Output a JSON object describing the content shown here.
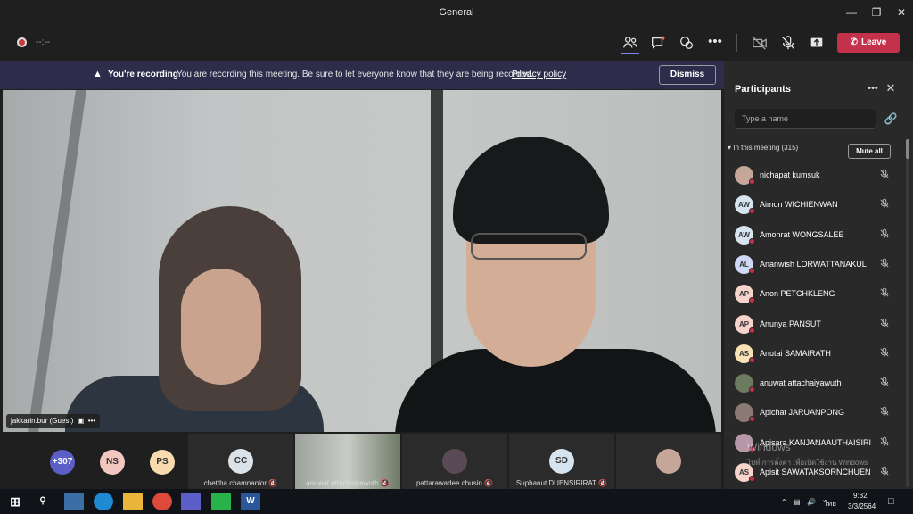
{
  "window": {
    "title": "General"
  },
  "toolbar": {
    "timer": "--:--",
    "leave_label": "Leave"
  },
  "banner": {
    "title": "You're recording",
    "text": "You are recording this meeting. Be sure to let everyone know that they are being recorded.",
    "link": "Privacy policy",
    "dismiss_label": "Dismiss"
  },
  "main_video": {
    "name_tag": "jakkarin.bur (Guest)"
  },
  "strip": {
    "overflow_count": "+307",
    "avatars": [
      {
        "initials": "NS",
        "color": "#f4c6c0"
      },
      {
        "initials": "PS",
        "color": "#f8dcb0"
      }
    ],
    "tiles": [
      {
        "name": "chettha chamnanlor",
        "initials": "CC",
        "kind": "avatar"
      },
      {
        "name": "anuwat attachaiyawuth",
        "kind": "video"
      },
      {
        "name": "pattarawadee chusin",
        "kind": "photo"
      },
      {
        "name": "Suphanut DUENSIRIRAT",
        "initials": "SD",
        "kind": "avatar"
      },
      {
        "name": "",
        "kind": "photo"
      }
    ]
  },
  "panel": {
    "title": "Participants",
    "search_placeholder": "Type a name",
    "section_label": "In this meeting (315)",
    "mute_all_label": "Mute all",
    "participants": [
      {
        "name": "nichapat kumsuk",
        "initials": "",
        "avatar_color": "#c7a69a",
        "photo": true
      },
      {
        "name": "Aimon WICHIENWAN",
        "initials": "AW",
        "avatar_color": "#d6e4f0"
      },
      {
        "name": "Amonrat WONGSALEE",
        "initials": "AW",
        "avatar_color": "#d6e4f0"
      },
      {
        "name": "Ananwish LORWATTANAKUL",
        "initials": "AL",
        "avatar_color": "#cfd8f5"
      },
      {
        "name": "Anon PETCHKLENG",
        "initials": "AP",
        "avatar_color": "#f6d4cc"
      },
      {
        "name": "Anunya PANSUT",
        "initials": "AP",
        "avatar_color": "#f6d4cc"
      },
      {
        "name": "Anutai SAMAIRATH",
        "initials": "AS",
        "avatar_color": "#f8e2b5"
      },
      {
        "name": "anuwat attachaiyawuth",
        "initials": "",
        "avatar_color": "#6c7a60",
        "photo": true
      },
      {
        "name": "Apichat JARUANPONG",
        "initials": "",
        "avatar_color": "#8a7c75",
        "photo": true
      },
      {
        "name": "Apisara KANJANAAUTHAISIRI",
        "initials": "",
        "avatar_color": "#b796a8",
        "photo": true
      },
      {
        "name": "Apisit SAWATAKSORNCHUEN",
        "initials": "AS",
        "avatar_color": "#f6d4cc"
      }
    ],
    "watermark_line1": "Windows",
    "watermark_line2": "ไปที่ การตั้งค่า เพื่อเปิดใช้งาน Windows"
  },
  "taskbar": {
    "lang": "ไทย",
    "time": "9:32",
    "date": "3/3/2564"
  },
  "colors": {
    "leave": "#c4314b",
    "banner": "#2d2c4a",
    "accent": "#7f85f5"
  }
}
